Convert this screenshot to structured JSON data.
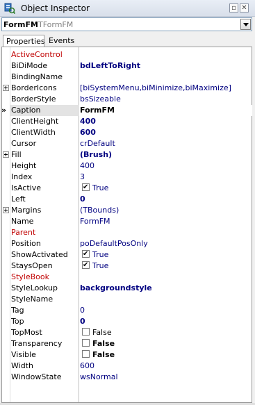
{
  "window": {
    "title": "Object Inspector"
  },
  "object_selector": {
    "name": "FormFM",
    "type": "TFormFM"
  },
  "tabs": [
    {
      "label": "Properties",
      "active": true
    },
    {
      "label": "Events",
      "active": false
    }
  ],
  "properties": [
    {
      "name": "ActiveControl",
      "value": "",
      "name_red": true
    },
    {
      "name": "BiDiMode",
      "value": "bdLeftToRight",
      "bold": true
    },
    {
      "name": "BindingName",
      "value": ""
    },
    {
      "name": "BorderIcons",
      "value": "[biSystemMenu,biMinimize,biMaximize]",
      "expandable": true
    },
    {
      "name": "BorderStyle",
      "value": "bsSizeable"
    },
    {
      "name": "Caption",
      "value": "FormFM",
      "bold": true,
      "selected": true
    },
    {
      "name": "ClientHeight",
      "value": "400",
      "bold": true
    },
    {
      "name": "ClientWidth",
      "value": "600",
      "bold": true
    },
    {
      "name": "Cursor",
      "value": "crDefault"
    },
    {
      "name": "Fill",
      "value": "(Brush)",
      "bold": true,
      "expandable": true
    },
    {
      "name": "Height",
      "value": "400"
    },
    {
      "name": "Index",
      "value": "3"
    },
    {
      "name": "IsActive",
      "value": "True",
      "checkbox": true,
      "checked": true
    },
    {
      "name": "Left",
      "value": "0",
      "bold": true
    },
    {
      "name": "Margins",
      "value": "(TBounds)",
      "expandable": true
    },
    {
      "name": "Name",
      "value": "FormFM"
    },
    {
      "name": "Parent",
      "value": "",
      "name_red": true
    },
    {
      "name": "Position",
      "value": "poDefaultPosOnly"
    },
    {
      "name": "ShowActivated",
      "value": "True",
      "checkbox": true,
      "checked": true
    },
    {
      "name": "StaysOpen",
      "value": "True",
      "checkbox": true,
      "checked": true
    },
    {
      "name": "StyleBook",
      "value": "",
      "name_red": true
    },
    {
      "name": "StyleLookup",
      "value": "backgroundstyle",
      "bold": true
    },
    {
      "name": "StyleName",
      "value": ""
    },
    {
      "name": "Tag",
      "value": "0"
    },
    {
      "name": "Top",
      "value": "0",
      "bold": true
    },
    {
      "name": "TopMost",
      "value": "False",
      "checkbox": true,
      "checked": false
    },
    {
      "name": "Transparency",
      "value": "False",
      "checkbox": true,
      "checked": false,
      "bold": true
    },
    {
      "name": "Visible",
      "value": "False",
      "checkbox": true,
      "checked": false,
      "bold": true
    },
    {
      "name": "Width",
      "value": "600"
    },
    {
      "name": "WindowState",
      "value": "wsNormal"
    }
  ],
  "selected_marker": "»",
  "icons": {
    "title": "object-inspector-icon",
    "pin": "pin-icon",
    "close": "close-icon",
    "dropdown": "chevron-down-icon",
    "expand": "plus-icon"
  },
  "colors": {
    "name_highlight": "#c00000",
    "value_text": "#000080"
  }
}
